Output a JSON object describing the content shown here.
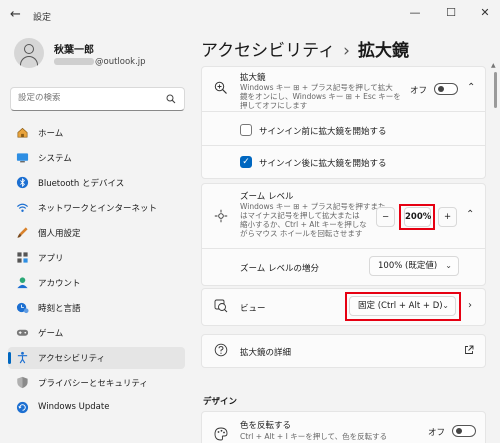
{
  "app": {
    "title": "設定"
  },
  "window_controls": {
    "minimize": "—",
    "maximize": "☐",
    "close": "✕"
  },
  "user": {
    "name": "秋葉一郎",
    "email_suffix": "@outlook.jp"
  },
  "search": {
    "placeholder": "設定の検索"
  },
  "sidebar": {
    "items": [
      {
        "label": "ホーム",
        "icon": "home-icon"
      },
      {
        "label": "システム",
        "icon": "system-monitor-icon"
      },
      {
        "label": "Bluetooth とデバイス",
        "icon": "bluetooth-icon"
      },
      {
        "label": "ネットワークとインターネット",
        "icon": "wifi-icon"
      },
      {
        "label": "個人用設定",
        "icon": "paintbrush-icon"
      },
      {
        "label": "アプリ",
        "icon": "apps-icon"
      },
      {
        "label": "アカウント",
        "icon": "account-icon"
      },
      {
        "label": "時刻と言語",
        "icon": "time-language-icon"
      },
      {
        "label": "ゲーム",
        "icon": "gamepad-icon"
      },
      {
        "label": "アクセシビリティ",
        "icon": "accessibility-icon",
        "active": true
      },
      {
        "label": "プライバシーとセキュリティ",
        "icon": "shield-icon"
      },
      {
        "label": "Windows Update",
        "icon": "windows-update-icon"
      }
    ]
  },
  "breadcrumb": {
    "parent": "アクセシビリティ",
    "separator": "›",
    "current": "拡大鏡"
  },
  "magnifier": {
    "title": "拡大鏡",
    "desc_line1": "Windows キー ⊞ + プラス記号を押して拡大",
    "desc_line2": "鏡をオンにし、Windows キー ⊞ + Esc キーを",
    "desc_line3": "押してオフにします",
    "toggle_label": "オフ",
    "toggle_on": false
  },
  "checkbox_before_signin": {
    "label": "サインイン前に拡大鏡を開始する",
    "checked": false
  },
  "checkbox_after_signin": {
    "label": "サインイン後に拡大鏡を開始する",
    "checked": true
  },
  "zoom": {
    "title": "ズーム レベル",
    "desc_line1": "Windows キー ⊞ + プラス記号を押すまた",
    "desc_line2": "はマイナス記号を押して拡大または",
    "desc_line3": "縮小するか、Ctrl + Alt キーを押しな",
    "desc_line4": "がらマウス ホイールを回転させます",
    "minus": "−",
    "value": "200%",
    "plus": "+",
    "increment_label": "ズーム レベルの増分",
    "increment_value": "100% (既定値)"
  },
  "view": {
    "title": "ビュー",
    "value": "固定 (Ctrl + Alt + D)"
  },
  "magnifier_details": {
    "title": "拡大鏡の詳細"
  },
  "design": {
    "section_title": "デザイン",
    "invert_title": "色を反転する",
    "invert_desc": "Ctrl + Alt + I キーを押して、色を反転する",
    "toggle_label": "オフ",
    "toggle_on": false
  },
  "colors": {
    "accent": "#0067c0",
    "highlight": "#e60012"
  }
}
